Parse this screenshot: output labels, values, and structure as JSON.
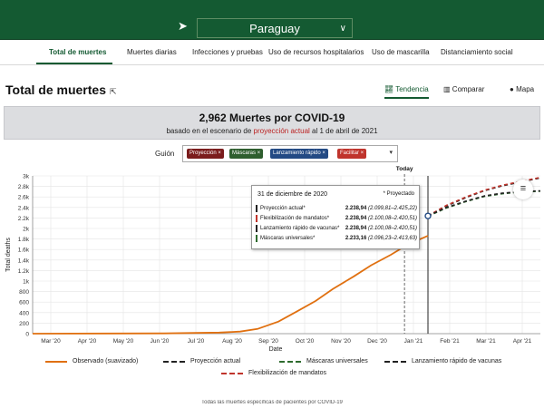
{
  "topbar": {
    "location_icon": "navigation-arrow-icon",
    "country": "Paraguay",
    "chevron_icon": "chevron-down-icon"
  },
  "nav": {
    "tabs": [
      {
        "label": "Total de muertes",
        "active": true
      },
      {
        "label": "Muertes diarias"
      },
      {
        "label": "Infecciones y pruebas"
      },
      {
        "label": "Uso de recursos hospitalarios"
      },
      {
        "label": "Uso de mascarilla"
      },
      {
        "label": "Distanciamiento social"
      }
    ]
  },
  "page": {
    "title": "Total de muertes",
    "title_icon": "external-link-icon"
  },
  "views": [
    {
      "label": "Tendencia",
      "icon": "line-chart-icon",
      "active": true
    },
    {
      "label": "Comparar",
      "icon": "bar-chart-icon"
    },
    {
      "label": "Mapa",
      "icon": "globe-icon"
    }
  ],
  "header_box": {
    "line1": "2,962 Muertes por COVID-19",
    "line2_prefix": "basado en el escenario de ",
    "line2_highlight": "proyección actual",
    "line2_suffix": " al 1 de abril de 2021"
  },
  "guion": {
    "label": "Guión",
    "chips": [
      {
        "label": "Proyección ×",
        "color": "#7b1c1c"
      },
      {
        "label": "Máscaras ×",
        "color": "#2e5e2e"
      },
      {
        "label": "Lanzamiento rápido ×",
        "color": "#234a84"
      },
      {
        "label": "Facilitar ×",
        "color": "#c0342c"
      }
    ],
    "chevron": "▾"
  },
  "tooltip": {
    "date": "31 de diciembre de 2020",
    "tag": "* Proyectado",
    "rows": [
      {
        "name": "Proyección actual*",
        "value": "2.238,94",
        "range": "(2.099,81–2.425,22)",
        "color": "#222222"
      },
      {
        "name": "Flexibilización de mandatos*",
        "value": "2.238,94",
        "range": "(2.100,08–2.420,51)",
        "color": "#c0342c"
      },
      {
        "name": "Lanzamiento rápido de vacunas*",
        "value": "2.238,94",
        "range": "(2.100,08–2.420,51)",
        "color": "#222222"
      },
      {
        "name": "Máscaras universales*",
        "value": "2.233,16",
        "range": "(2.096,23–2.413,63)",
        "color": "#2e6b2e"
      }
    ]
  },
  "menu_icon": "hamburger-menu-icon",
  "chart_data": {
    "type": "line",
    "ylabel": "Total deaths",
    "xlabel": "Date",
    "today_label": "Today",
    "y_ticks": [
      "0",
      "200",
      "400",
      "600",
      "800",
      "1k",
      "1.2k",
      "1.4k",
      "1.6k",
      "1.8k",
      "2k",
      "2.2k",
      "2.4k",
      "2.6k",
      "2.8k",
      "3k"
    ],
    "ylim": [
      0,
      3000
    ],
    "x_ticks": [
      "Mar '20",
      "Apr '20",
      "May '20",
      "Jun '20",
      "Jul '20",
      "Aug '20",
      "Sep '20",
      "Oct '20",
      "Nov '20",
      "Dec '20",
      "Jan '21",
      "Feb '21",
      "Mar '21",
      "Apr '21"
    ],
    "xlim": [
      "2020-02-15",
      "2021-04-01"
    ],
    "grid": true,
    "series": [
      {
        "name": "Observado (suavizado)",
        "color": "#e07010",
        "style": "solid",
        "points": [
          [
            "2020-02-15",
            0
          ],
          [
            "2020-06-01",
            5
          ],
          [
            "2020-07-15",
            20
          ],
          [
            "2020-08-01",
            40
          ],
          [
            "2020-08-15",
            90
          ],
          [
            "2020-09-01",
            230
          ],
          [
            "2020-09-15",
            410
          ],
          [
            "2020-10-01",
            620
          ],
          [
            "2020-10-15",
            850
          ],
          [
            "2020-11-01",
            1090
          ],
          [
            "2020-11-15",
            1300
          ],
          [
            "2020-12-01",
            1500
          ],
          [
            "2020-12-15",
            1700
          ],
          [
            "2020-12-31",
            1860
          ]
        ]
      },
      {
        "name": "Proyección actual",
        "color": "#222222",
        "style": "dashed",
        "points": [
          [
            "2020-12-31",
            2238.94
          ],
          [
            "2021-01-15",
            2430
          ],
          [
            "2021-02-01",
            2600
          ],
          [
            "2021-02-15",
            2720
          ],
          [
            "2021-03-01",
            2810
          ],
          [
            "2021-03-15",
            2880
          ],
          [
            "2021-04-01",
            2962
          ]
        ]
      },
      {
        "name": "Máscaras universales",
        "color": "#2e6b2e",
        "style": "dashed",
        "points": [
          [
            "2020-12-31",
            2233.16
          ],
          [
            "2021-01-15",
            2390
          ],
          [
            "2021-02-01",
            2520
          ],
          [
            "2021-02-15",
            2610
          ],
          [
            "2021-03-01",
            2660
          ],
          [
            "2021-03-15",
            2690
          ],
          [
            "2021-04-01",
            2710
          ]
        ]
      },
      {
        "name": "Lanzamiento rápido de vacunas",
        "color": "#222222",
        "style": "dashed",
        "points": [
          [
            "2020-12-31",
            2238.94
          ],
          [
            "2021-01-15",
            2400
          ],
          [
            "2021-02-01",
            2530
          ],
          [
            "2021-02-15",
            2620
          ],
          [
            "2021-03-01",
            2670
          ],
          [
            "2021-03-15",
            2700
          ],
          [
            "2021-04-01",
            2715
          ]
        ]
      },
      {
        "name": "Flexibilización de mandatos",
        "color": "#c0342c",
        "style": "dashed",
        "points": [
          [
            "2020-12-31",
            2238.94
          ],
          [
            "2021-01-15",
            2440
          ],
          [
            "2021-02-01",
            2610
          ],
          [
            "2021-02-15",
            2730
          ],
          [
            "2021-03-01",
            2820
          ],
          [
            "2021-03-15",
            2890
          ],
          [
            "2021-04-01",
            2970
          ]
        ]
      }
    ],
    "today": "2020-12-12",
    "hover_date": "2020-12-31"
  },
  "footnote": "Todas las muertes específicas de pacientes por COVID-19"
}
